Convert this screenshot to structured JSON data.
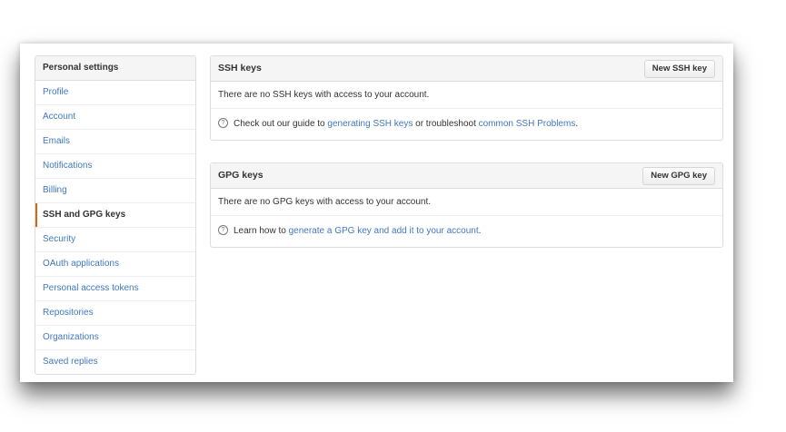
{
  "sidebar": {
    "header": "Personal settings",
    "items": [
      {
        "label": "Profile"
      },
      {
        "label": "Account"
      },
      {
        "label": "Emails"
      },
      {
        "label": "Notifications"
      },
      {
        "label": "Billing"
      },
      {
        "label": "SSH and GPG keys",
        "selected": true
      },
      {
        "label": "Security"
      },
      {
        "label": "OAuth applications"
      },
      {
        "label": "Personal access tokens"
      },
      {
        "label": "Repositories"
      },
      {
        "label": "Organizations"
      },
      {
        "label": "Saved replies"
      }
    ]
  },
  "ssh": {
    "title": "SSH keys",
    "button": "New SSH key",
    "empty": "There are no SSH keys with access to your account.",
    "help_prefix": "Check out our guide to ",
    "help_link1": "generating SSH keys",
    "help_middle": " or troubleshoot ",
    "help_link2": "common SSH Problems",
    "help_suffix": "."
  },
  "gpg": {
    "title": "GPG keys",
    "button": "New GPG key",
    "empty": "There are no GPG keys with access to your account.",
    "help_prefix": "Learn how to ",
    "help_link": "generate a GPG key and add it to your account",
    "help_suffix": "."
  },
  "icons": {
    "help": "question-circle-icon"
  },
  "colors": {
    "link": "#4078c0",
    "selected_accent": "#d26911"
  }
}
